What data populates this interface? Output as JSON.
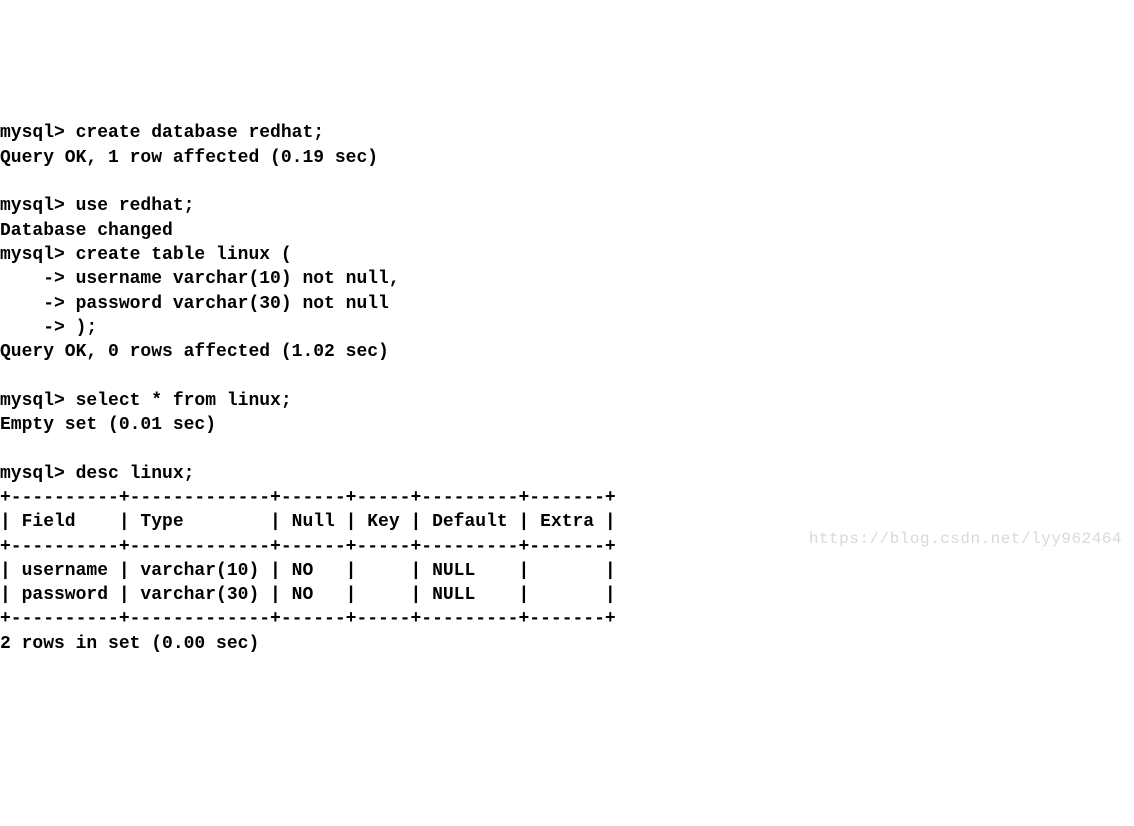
{
  "lines": {
    "l1": "mysql> create database redhat;",
    "l2": "Query OK, 1 row affected (0.19 sec)",
    "l3": "",
    "l4": "mysql> use redhat;",
    "l5": "Database changed",
    "l6": "mysql> create table linux (",
    "l7": "    -> username varchar(10) not null,",
    "l8": "    -> password varchar(30) not null",
    "l9": "    -> );",
    "l10": "Query OK, 0 rows affected (1.02 sec)",
    "l11": "",
    "l12": "mysql> select * from linux;",
    "l13": "Empty set (0.01 sec)",
    "l14": "",
    "l15": "mysql> desc linux;",
    "l16": "+----------+-------------+------+-----+---------+-------+",
    "l17": "| Field    | Type        | Null | Key | Default | Extra |",
    "l18": "+----------+-------------+------+-----+---------+-------+",
    "l19": "| username | varchar(10) | NO   |     | NULL    |       |",
    "l20": "| password | varchar(30) | NO   |     | NULL    |       |",
    "l21": "+----------+-------------+------+-----+---------+-------+",
    "l22": "2 rows in set (0.00 sec)"
  },
  "watermark": "https://blog.csdn.net/lyy962464"
}
